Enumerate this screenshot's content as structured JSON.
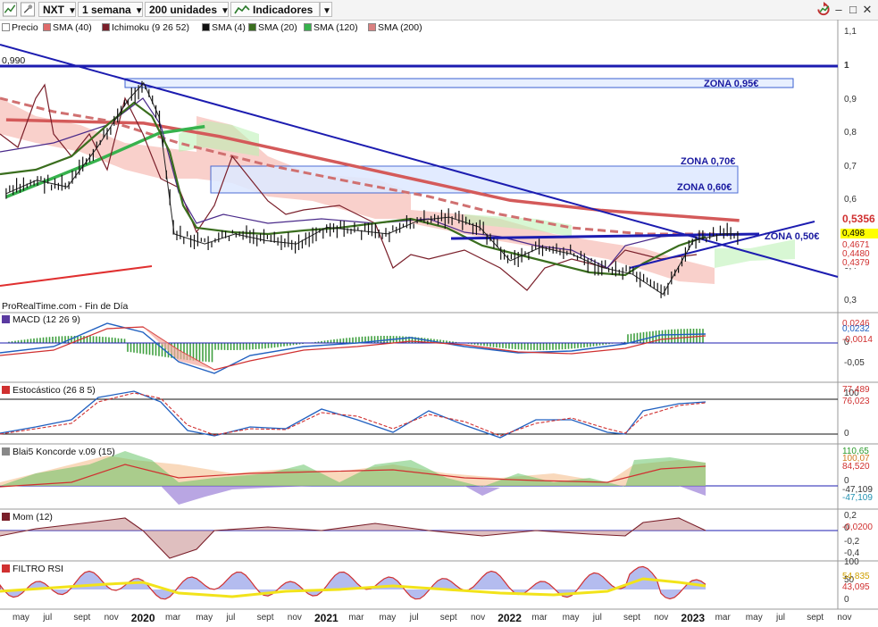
{
  "toolbar": {
    "instrument": "NXT",
    "period": "1 semana",
    "units": "200 unidades",
    "indicators": "Indicadores"
  },
  "legend": [
    {
      "label": "Precio",
      "color": "#ffffff"
    },
    {
      "label": "SMA (40)",
      "color": "#e06c6c"
    },
    {
      "label": "Ichimoku (9 26 52)",
      "color": "#7a1f2a"
    },
    {
      "label": "SMA (4)",
      "color": "#111111"
    },
    {
      "label": "SMA (20)",
      "color": "#3a6e1e"
    },
    {
      "label": "SMA (120)",
      "color": "#37b24d"
    },
    {
      "label": "SMA (200)",
      "color": "#d98080"
    }
  ],
  "price_panel": {
    "level_label": "0,990",
    "source_label": "ProRealTime.com - Fin de Día",
    "zones": [
      "ZONA 0,95€",
      "ZONA 0,70€",
      "ZONA 0,60€",
      "ZONA 0,50€"
    ],
    "axis_ticks": [
      "1,1",
      "1",
      "0,9",
      "0,8",
      "0,7",
      "0,6",
      "0,5",
      "0,4",
      "0,3"
    ],
    "tags": [
      {
        "text": "0,5356",
        "bg": "#ffffff",
        "fg": "#d03030"
      },
      {
        "text": "0,498",
        "bg": "#ffff00",
        "fg": "#000000"
      },
      {
        "text": "0,4671",
        "bg": "#ffffff",
        "fg": "#d03030"
      },
      {
        "text": "0,4480",
        "bg": "#ffffff",
        "fg": "#d03030"
      },
      {
        "text": "0,4379",
        "bg": "#ffffff",
        "fg": "#d03030"
      }
    ]
  },
  "macd": {
    "title": "MACD (12 26 9)",
    "axis_ticks": [
      "0",
      "-0,05"
    ],
    "tags": [
      "0,0246",
      "0,0232",
      "-0,0014"
    ]
  },
  "stoch": {
    "title": "Estocástico (26 8 5)",
    "axis_ticks": [
      "100",
      "0"
    ],
    "tags": [
      "77,489",
      "76,023"
    ]
  },
  "koncorde": {
    "title": "Blai5 Koncorde v.09 (15)",
    "axis_ticks": [
      "0"
    ],
    "tags": [
      "110,65",
      "100,07",
      "84,520",
      "-47,109",
      "-47,109"
    ]
  },
  "mom": {
    "title": "Mom (12)",
    "axis_ticks": [
      "0,2",
      "0",
      "-0,2",
      "-0,4"
    ],
    "tags": [
      "-0,0200"
    ]
  },
  "rsi": {
    "title": "FILTRO RSI",
    "axis_ticks": [
      "100",
      "50",
      "0"
    ],
    "tags": [
      "54,835",
      "43,095"
    ]
  },
  "xaxis": {
    "labels": [
      "may",
      "jul",
      "sept",
      "nov",
      "2020",
      "mar",
      "may",
      "jul",
      "sept",
      "nov",
      "2021",
      "mar",
      "may",
      "jul",
      "sept",
      "nov",
      "2022",
      "mar",
      "may",
      "jul",
      "sept",
      "nov",
      "2023",
      "mar",
      "may",
      "jul",
      "sept",
      "nov"
    ]
  },
  "chart_data": {
    "type": "line",
    "title": "NXT",
    "period": "1 semana",
    "y_range": [
      0.28,
      1.12
    ],
    "x_range": [
      "2019-04",
      "2023-12"
    ],
    "series": [
      {
        "name": "Precio",
        "x": [
          "2019-04",
          "2019-06",
          "2019-08",
          "2019-10",
          "2019-12",
          "2020-01",
          "2020-02",
          "2020-03",
          "2020-05",
          "2020-07",
          "2020-09",
          "2020-11",
          "2021-01",
          "2021-03",
          "2021-05",
          "2021-07",
          "2021-09",
          "2021-11",
          "2022-01",
          "2022-03",
          "2022-05",
          "2022-07",
          "2022-09",
          "2022-11",
          "2023-01",
          "2023-03",
          "2023-04"
        ],
        "y": [
          0.62,
          0.66,
          0.64,
          0.76,
          0.9,
          0.95,
          0.85,
          0.5,
          0.47,
          0.5,
          0.48,
          0.47,
          0.52,
          0.51,
          0.5,
          0.54,
          0.55,
          0.52,
          0.42,
          0.46,
          0.44,
          0.4,
          0.38,
          0.32,
          0.48,
          0.5,
          0.5
        ]
      },
      {
        "name": "SMA (200)",
        "x": [
          "2019-04",
          "2020-01",
          "2020-06",
          "2021-01",
          "2021-07",
          "2022-01",
          "2022-07",
          "2023-01",
          "2023-04"
        ],
        "y": [
          0.84,
          0.83,
          0.79,
          0.72,
          0.66,
          0.6,
          0.57,
          0.55,
          0.54
        ]
      },
      {
        "name": "SMA (120)",
        "x": [
          "2019-04",
          "2019-10",
          "2020-02",
          "2020-05"
        ],
        "y": [
          0.61,
          0.72,
          0.8,
          0.82
        ]
      }
    ],
    "levels": [
      {
        "value": 0.99,
        "label": "0,990"
      }
    ],
    "zones": [
      {
        "label": "ZONA 0,95€",
        "from": 0.93,
        "to": 0.95
      },
      {
        "label": "ZONA 0,70€",
        "from": 0.62,
        "to": 0.7
      },
      {
        "label": "ZONA 0,60€",
        "from": 0.62,
        "to": 0.6
      },
      {
        "label": "ZONA 0,50€",
        "from": 0.49,
        "to": 0.5
      }
    ]
  }
}
